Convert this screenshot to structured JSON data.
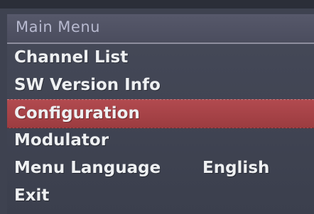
{
  "menu": {
    "title": "Main Menu",
    "items": [
      {
        "label": "Channel List",
        "value": "",
        "selected": false
      },
      {
        "label": "SW Version Info",
        "value": "",
        "selected": false
      },
      {
        "label": "Configuration",
        "value": "",
        "selected": true
      },
      {
        "label": "Modulator",
        "value": "",
        "selected": false
      },
      {
        "label": "Menu Language",
        "value": "English",
        "selected": false
      },
      {
        "label": "Exit",
        "value": "",
        "selected": false
      }
    ]
  },
  "colors": {
    "background": "#3e4250",
    "selected_row": "#aa4347",
    "title_text": "#b7b9cf",
    "item_text": "#eef0f2"
  }
}
